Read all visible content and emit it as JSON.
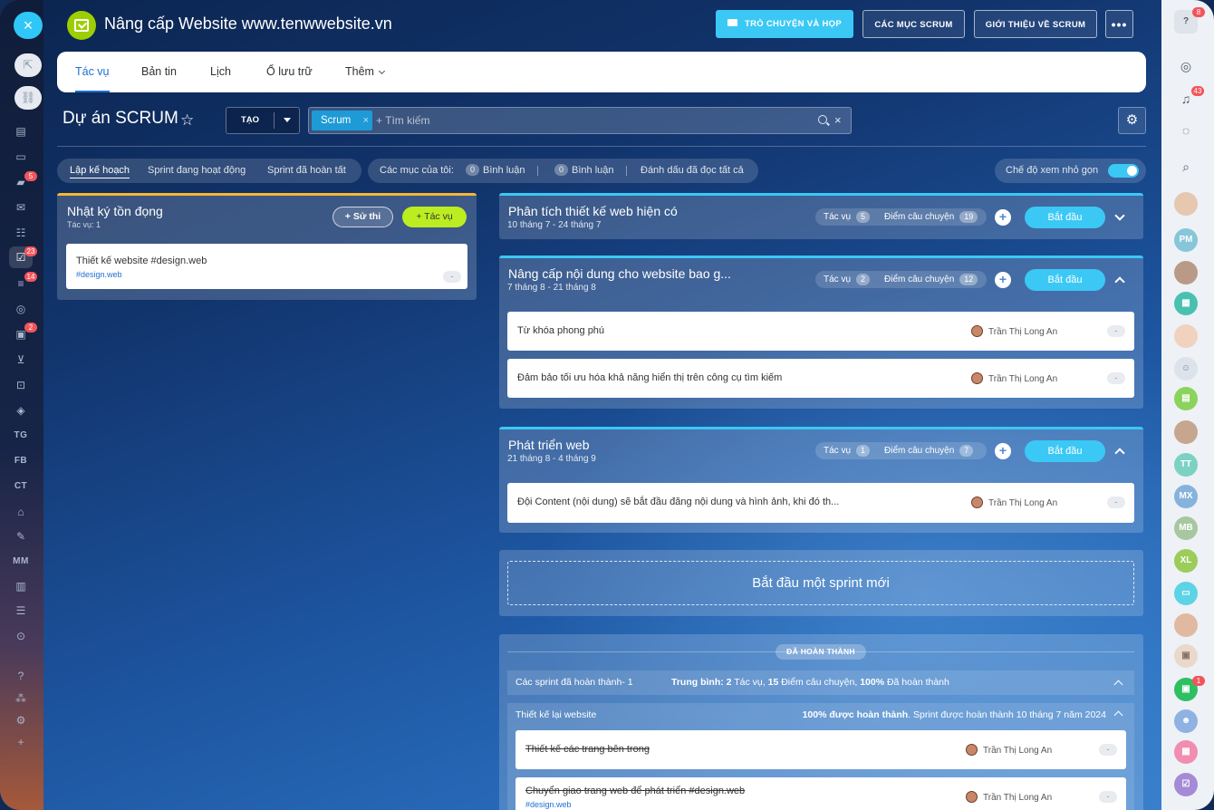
{
  "window_title": "Nâng cấp Website www.tenwwebsite.vn",
  "header_buttons": {
    "chat": "Trò chuyện và họp",
    "scrum_items": "Các mục Scrum",
    "about_scrum": "Giới thiệu về Scrum",
    "more": "•••"
  },
  "tabs": [
    "Tác vụ",
    "Bản tin",
    "Lịch",
    "Ổ lưu trữ",
    "Thêm"
  ],
  "page": {
    "title": "Dự án SCRUM",
    "create_label": "TẠO"
  },
  "search": {
    "tag": "Scrum",
    "placeholder": "+ Tìm kiếm"
  },
  "filters": {
    "view_tabs": [
      "Lập kế hoạch",
      "Sprint đang hoạt động",
      "Sprint đã hoàn tất"
    ],
    "my_items_label": "Các mục của tôi:",
    "comments1_count": "0",
    "comments1_label": "Bình luận",
    "comments2_count": "0",
    "comments2_label": "Bình luận",
    "mark_read": "Đánh dấu đã đọc tất cả",
    "compact_label": "Chế độ xem nhỏ gọn"
  },
  "backlog": {
    "title": "Nhật ký tồn đọng",
    "subtitle": "Tác vụ: 1",
    "epic_button": "Sử thi",
    "task_button": "Tác vụ",
    "items": [
      {
        "title": "Thiết kế website #design.web",
        "tag": "#design.web",
        "points": "-"
      }
    ]
  },
  "sprints": [
    {
      "name": "Phân tích thiết kế web hiện có",
      "dates": "10 tháng 7 - 24 tháng 7",
      "tasks_label": "Tác vụ",
      "tasks": "5",
      "points_label": "Điểm câu chuyện",
      "points": "19",
      "start_label": "Bắt đầu",
      "items": []
    },
    {
      "name": "Nâng cấp nội dung cho website bao g...",
      "dates": "7 tháng 8 - 21 tháng 8",
      "tasks_label": "Tác vụ",
      "tasks": "2",
      "points_label": "Điểm câu chuyện",
      "points": "12",
      "start_label": "Bắt đầu",
      "items": [
        {
          "title": "Từ khóa phong phú",
          "assignee": "Trần Thị Long An",
          "points": "-"
        },
        {
          "title": "Đảm bảo tối ưu hóa khả năng hiển thị trên công cụ tìm kiếm",
          "assignee": "Trần Thị Long An",
          "points": "-"
        }
      ]
    },
    {
      "name": "Phát triển web",
      "dates": "21 tháng 8 - 4 tháng 9",
      "tasks_label": "Tác vụ",
      "tasks": "1",
      "points_label": "Điểm câu chuyện",
      "points": "7",
      "start_label": "Bắt đầu",
      "items": [
        {
          "title": "Đội Content (nội dung) sẽ bắt đầu đăng nội dung và hình ảnh, khi đó th...",
          "assignee": "Trần Thị Long An",
          "points": "-"
        }
      ]
    }
  ],
  "new_sprint": "Bắt đầu một sprint mới",
  "completed": {
    "label": "ĐÃ HOÀN THÀNH",
    "summary_left": "Các sprint đã hoàn thành- 1",
    "summary_avg_label": "Trung bình:",
    "summary_tasks": "2",
    "summary_tasks_text": "Tác vụ,",
    "summary_points": "15",
    "summary_points_text": "Điểm câu chuyện,",
    "summary_pct": "100%",
    "summary_pct_text": "Đã hoàn thành",
    "sprint_name": "Thiết kế lại website",
    "sprint_pct": "100% được hoàn thành",
    "sprint_done_text": ". Sprint được hoàn thành 10 tháng 7 năm 2024",
    "items": [
      {
        "title": "Thiết kế các trang bên trong",
        "assignee": "Trần Thị Long An",
        "points": "-"
      },
      {
        "title": "Chuyển giao trang web để phát triển #design.web",
        "tag": "#design.web",
        "assignee": "Trần Thị Long An",
        "points": "-"
      }
    ]
  },
  "left_sidebar": {
    "close": "×",
    "labels": [
      "TG",
      "FB",
      "CT",
      "MM"
    ],
    "badges": [
      "5",
      "23",
      "14",
      "2"
    ]
  },
  "right_sidebar": {
    "avatars": [
      "PM",
      "TT",
      "MX",
      "MB",
      "XL"
    ],
    "badges": [
      "8",
      "43",
      "1"
    ]
  }
}
